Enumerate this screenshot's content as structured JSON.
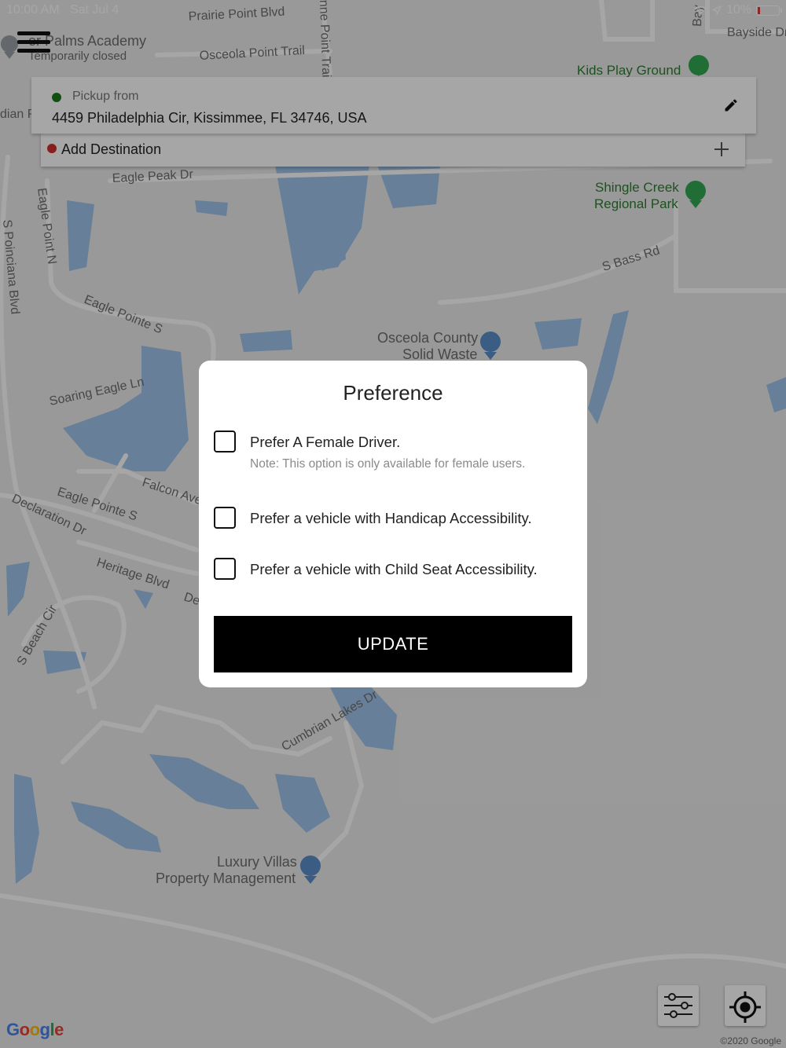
{
  "status_bar": {
    "time": "10:00 AM",
    "date": "Sat Jul 4",
    "battery": "10%"
  },
  "map": {
    "labels": {
      "prairie": "Prairie Point Blvd",
      "palms": "er Palms Academy",
      "palms_status": "Temporarily closed",
      "osceola_trail": "Osceola Point Trail",
      "point_trail": "nne Point Trail",
      "bayside": "Bayside Dr",
      "bay": "Bay",
      "kids": "Kids Play Ground",
      "dian": "dian P",
      "eagle_peak": "Eagle Peak Dr",
      "eagle_point_n": "Eagle Point N",
      "poinciana": "S Poinciana Blvd",
      "shingle1": "Shingle Creek",
      "shingle2": "Regional Park",
      "bass": "S Bass Rd",
      "eagle_pointe_s1": "Eagle Pointe S",
      "osceola1": "Osceola County",
      "osceola2": "Solid Waste",
      "soaring": "Soaring Eagle Ln",
      "falcon": "Falcon Ave",
      "eagle_pointe_s2": "Eagle Pointe S",
      "declaration": "Declaration Dr",
      "heritage": "Heritage Blvd",
      "dec": "Dec",
      "beach": "S Beach Cir",
      "cumbrian": "Cumbrian Lakes Dr",
      "luxury1": "Luxury Villas",
      "luxury2": "Property Management"
    },
    "google": "Google",
    "copyright": "©2020 Google"
  },
  "pickup": {
    "label": "Pickup from",
    "address": "4459 Philadelphia Cir,  Kissimmee,  FL 34746,  USA"
  },
  "destination": {
    "label": "Add Destination"
  },
  "modal": {
    "title": "Preference",
    "options": [
      {
        "label": "Prefer A Female Driver.",
        "note": "Note: This option is only available for female users.",
        "checked": false
      },
      {
        "label": "Prefer a vehicle with Handicap Accessibility.",
        "checked": false
      },
      {
        "label": "Prefer a vehicle with Child Seat Accessibility.",
        "checked": false
      }
    ],
    "button": "UPDATE"
  }
}
